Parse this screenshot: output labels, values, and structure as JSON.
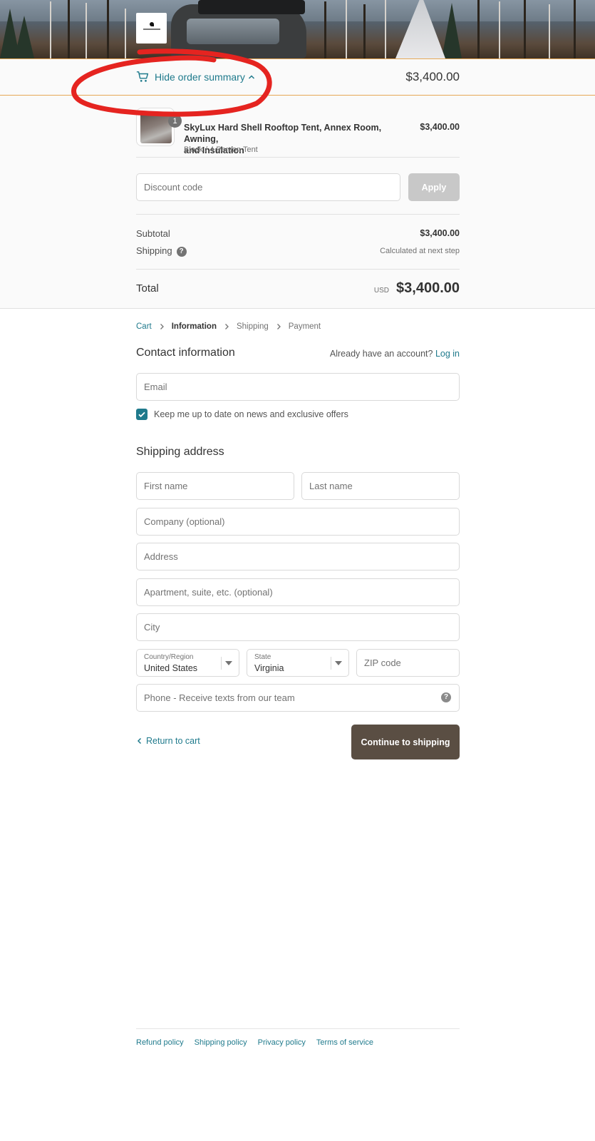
{
  "banner": {
    "logo_alt": "store-logo"
  },
  "summary_toggle": {
    "label": "Hide order summary",
    "total": "$3,400.00"
  },
  "order_summary": {
    "item": {
      "quantity": "1",
      "name_line1": "SkyLux Hard Shell Rooftop Tent, Annex Room, Awning,",
      "name_line2": "and Insulation",
      "variant": "Black / 4 Person Tent",
      "price": "$3,400.00"
    },
    "discount": {
      "placeholder": "Discount code",
      "apply_label": "Apply"
    },
    "subtotal_label": "Subtotal",
    "subtotal_value": "$3,400.00",
    "shipping_label": "Shipping",
    "shipping_value": "Calculated at next step",
    "total_label": "Total",
    "currency": "USD",
    "total_value": "$3,400.00"
  },
  "breadcrumb": [
    "Cart",
    "Information",
    "Shipping",
    "Payment"
  ],
  "contact": {
    "title": "Contact information",
    "account_prompt": "Already have an account?",
    "login_label": "Log in",
    "email_placeholder": "Email",
    "newsletter_label": "Keep me up to date on news and exclusive offers",
    "newsletter_checked": true
  },
  "shipping": {
    "title": "Shipping address",
    "first_name_placeholder": "First name",
    "last_name_placeholder": "Last name",
    "company_placeholder": "Company (optional)",
    "address_placeholder": "Address",
    "apartment_placeholder": "Apartment, suite, etc. (optional)",
    "city_placeholder": "City",
    "country_caption": "Country/Region",
    "country_value": "United States",
    "state_caption": "State",
    "state_value": "Virginia",
    "zip_placeholder": "ZIP code",
    "phone_placeholder": "Phone - Receive texts from our team"
  },
  "actions": {
    "return_label": "Return to cart",
    "continue_label": "Continue to shipping"
  },
  "footer": {
    "links": [
      "Refund policy",
      "Shipping policy",
      "Privacy policy",
      "Terms of service"
    ]
  },
  "colors": {
    "link": "#1f7a8c",
    "continue_button": "#5a4e43",
    "annotation": "#e52420"
  }
}
